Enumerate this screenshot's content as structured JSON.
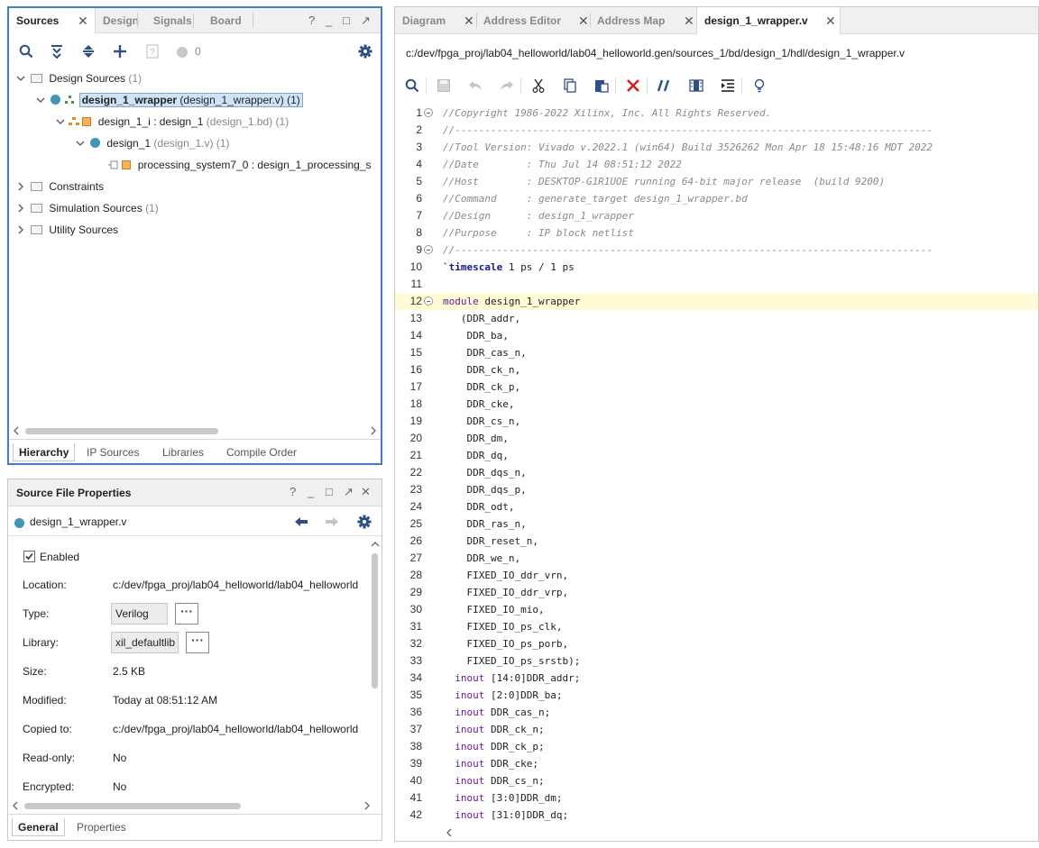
{
  "sources_panel": {
    "tabs": [
      {
        "label": "Sources",
        "active": true
      },
      {
        "label": "Design",
        "active": false
      },
      {
        "label": "Signals",
        "active": false
      },
      {
        "label": "Board",
        "active": false
      }
    ],
    "window_controls": [
      "?",
      "_",
      "□",
      "↗"
    ],
    "toolbar": {
      "count": "0"
    },
    "tree": [
      {
        "label": "Design Sources",
        "count": "(1)"
      },
      {
        "label": "design_1_wrapper",
        "detail": "(design_1_wrapper.v) (1)"
      },
      {
        "label": "design_1_i : design_1",
        "detail": "(design_1.bd)",
        "count": "(1)"
      },
      {
        "label": "design_1",
        "detail": "(design_1.v)",
        "count": "(1)"
      },
      {
        "label": "processing_system7_0 : design_1_processing_s"
      },
      {
        "label": "Constraints"
      },
      {
        "label": "Simulation Sources",
        "count": "(1)"
      },
      {
        "label": "Utility Sources"
      }
    ],
    "bottom_tabs": [
      "Hierarchy",
      "IP Sources",
      "Libraries",
      "Compile Order"
    ]
  },
  "properties_panel": {
    "title": "Source File Properties",
    "window_controls": [
      "?",
      "_",
      "□",
      "↗",
      "✕"
    ],
    "file_name": "design_1_wrapper.v",
    "enabled_label": "Enabled",
    "enabled_checked": true,
    "rows": [
      {
        "label": "Location:",
        "value": "c:/dev/fpga_proj/lab04_helloworld/lab04_helloworld"
      },
      {
        "label": "Type:",
        "value": "Verilog"
      },
      {
        "label": "Library:",
        "value": "xil_defaultlib"
      },
      {
        "label": "Size:",
        "value": "2.5 KB"
      },
      {
        "label": "Modified:",
        "value": "Today at 08:51:12 AM"
      },
      {
        "label": "Copied to:",
        "value": "c:/dev/fpga_proj/lab04_helloworld/lab04_helloworld"
      },
      {
        "label": "Read-only:",
        "value": "No"
      },
      {
        "label": "Encrypted:",
        "value": "No"
      }
    ],
    "bottom_tabs": [
      "General",
      "Properties"
    ],
    "dots": "···"
  },
  "editor_panel": {
    "tabs": [
      {
        "label": "Diagram",
        "active": false
      },
      {
        "label": "Address Editor",
        "active": false
      },
      {
        "label": "Address Map",
        "active": false
      },
      {
        "label": "design_1_wrapper.v",
        "active": true
      }
    ],
    "file_path": "c:/dev/fpga_proj/lab04_helloworld/lab04_helloworld.gen/sources_1/bd/design_1/hdl/design_1_wrapper.v",
    "lines": [
      {
        "n": "1",
        "text": "//Copyright 1986-2022 Xilinx, Inc. All Rights Reserved.",
        "type": "comment",
        "fold": true
      },
      {
        "n": "2",
        "text": "//--------------------------------------------------------------------------------",
        "type": "comment"
      },
      {
        "n": "3",
        "text": "//Tool Version: Vivado v.2022.1 (win64) Build 3526262 Mon Apr 18 15:48:16 MDT 2022",
        "type": "comment"
      },
      {
        "n": "4",
        "text": "//Date        : Thu Jul 14 08:51:12 2022",
        "type": "comment"
      },
      {
        "n": "5",
        "text": "//Host        : DESKTOP-G1R1UOE running 64-bit major release  (build 9200)",
        "type": "comment"
      },
      {
        "n": "6",
        "text": "//Command     : generate_target design_1_wrapper.bd",
        "type": "comment"
      },
      {
        "n": "7",
        "text": "//Design      : design_1_wrapper",
        "type": "comment"
      },
      {
        "n": "8",
        "text": "//Purpose     : IP block netlist",
        "type": "comment"
      },
      {
        "n": "9",
        "text": "//--------------------------------------------------------------------------------",
        "type": "comment",
        "fold": true
      },
      {
        "n": "10",
        "text": "`timescale 1 ps / 1 ps",
        "type": "timescale"
      },
      {
        "n": "11",
        "text": "",
        "type": "plain"
      },
      {
        "n": "12",
        "text": "module design_1_wrapper",
        "type": "module",
        "fold": true,
        "highlight": true
      },
      {
        "n": "13",
        "text": "   (DDR_addr,",
        "type": "plain"
      },
      {
        "n": "14",
        "text": "    DDR_ba,",
        "type": "plain"
      },
      {
        "n": "15",
        "text": "    DDR_cas_n,",
        "type": "plain"
      },
      {
        "n": "16",
        "text": "    DDR_ck_n,",
        "type": "plain"
      },
      {
        "n": "17",
        "text": "    DDR_ck_p,",
        "type": "plain"
      },
      {
        "n": "18",
        "text": "    DDR_cke,",
        "type": "plain"
      },
      {
        "n": "19",
        "text": "    DDR_cs_n,",
        "type": "plain"
      },
      {
        "n": "20",
        "text": "    DDR_dm,",
        "type": "plain"
      },
      {
        "n": "21",
        "text": "    DDR_dq,",
        "type": "plain"
      },
      {
        "n": "22",
        "text": "    DDR_dqs_n,",
        "type": "plain"
      },
      {
        "n": "23",
        "text": "    DDR_dqs_p,",
        "type": "plain"
      },
      {
        "n": "24",
        "text": "    DDR_odt,",
        "type": "plain"
      },
      {
        "n": "25",
        "text": "    DDR_ras_n,",
        "type": "plain"
      },
      {
        "n": "26",
        "text": "    DDR_reset_n,",
        "type": "plain"
      },
      {
        "n": "27",
        "text": "    DDR_we_n,",
        "type": "plain"
      },
      {
        "n": "28",
        "text": "    FIXED_IO_ddr_vrn,",
        "type": "plain"
      },
      {
        "n": "29",
        "text": "    FIXED_IO_ddr_vrp,",
        "type": "plain"
      },
      {
        "n": "30",
        "text": "    FIXED_IO_mio,",
        "type": "plain"
      },
      {
        "n": "31",
        "text": "    FIXED_IO_ps_clk,",
        "type": "plain"
      },
      {
        "n": "32",
        "text": "    FIXED_IO_ps_porb,",
        "type": "plain"
      },
      {
        "n": "33",
        "text": "    FIXED_IO_ps_srstb);",
        "type": "plain"
      },
      {
        "n": "34",
        "kw": "  inout ",
        "text": "[14:0]DDR_addr;",
        "type": "inout"
      },
      {
        "n": "35",
        "kw": "  inout ",
        "text": "[2:0]DDR_ba;",
        "type": "inout"
      },
      {
        "n": "36",
        "kw": "  inout ",
        "text": "DDR_cas_n;",
        "type": "inout"
      },
      {
        "n": "37",
        "kw": "  inout ",
        "text": "DDR_ck_n;",
        "type": "inout"
      },
      {
        "n": "38",
        "kw": "  inout ",
        "text": "DDR_ck_p;",
        "type": "inout"
      },
      {
        "n": "39",
        "kw": "  inout ",
        "text": "DDR_cke;",
        "type": "inout"
      },
      {
        "n": "40",
        "kw": "  inout ",
        "text": "DDR_cs_n;",
        "type": "inout"
      },
      {
        "n": "41",
        "kw": "  inout ",
        "text": "[3:0]DDR_dm;",
        "type": "inout"
      },
      {
        "n": "42",
        "kw": "  inout ",
        "text": "[31:0]DDR_dq;",
        "type": "inout"
      }
    ]
  }
}
